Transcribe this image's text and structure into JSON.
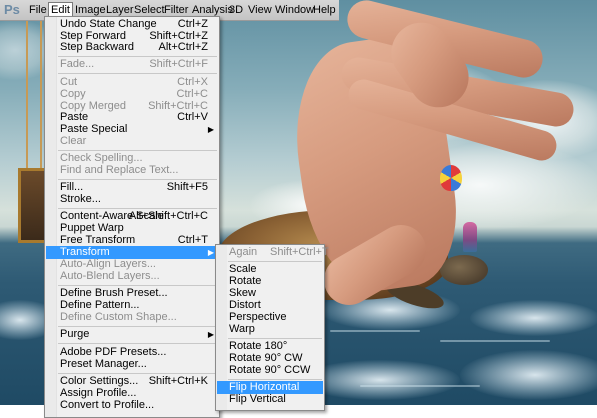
{
  "app": {
    "logo_text": "Ps"
  },
  "menubar": {
    "items": [
      {
        "label": "File"
      },
      {
        "label": "Edit"
      },
      {
        "label": "Image"
      },
      {
        "label": "Layer"
      },
      {
        "label": "Select"
      },
      {
        "label": "Filter"
      },
      {
        "label": "Analysis"
      },
      {
        "label": "3D"
      },
      {
        "label": "View"
      },
      {
        "label": "Window"
      },
      {
        "label": "Help"
      }
    ]
  },
  "edit_menu": {
    "items": [
      {
        "label": "Undo State Change",
        "shortcut": "Ctrl+Z",
        "enabled": true
      },
      {
        "label": "Step Forward",
        "shortcut": "Shift+Ctrl+Z",
        "enabled": true
      },
      {
        "label": "Step Backward",
        "shortcut": "Alt+Ctrl+Z",
        "enabled": true
      },
      {
        "label": "Fade...",
        "shortcut": "Shift+Ctrl+F",
        "enabled": false
      },
      {
        "label": "Cut",
        "shortcut": "Ctrl+X",
        "enabled": false
      },
      {
        "label": "Copy",
        "shortcut": "Ctrl+C",
        "enabled": false
      },
      {
        "label": "Copy Merged",
        "shortcut": "Shift+Ctrl+C",
        "enabled": false
      },
      {
        "label": "Paste",
        "shortcut": "Ctrl+V",
        "enabled": true
      },
      {
        "label": "Paste Special",
        "shortcut": "",
        "enabled": true,
        "submenu": true
      },
      {
        "label": "Clear",
        "shortcut": "",
        "enabled": false
      },
      {
        "label": "Check Spelling...",
        "shortcut": "",
        "enabled": false
      },
      {
        "label": "Find and Replace Text...",
        "shortcut": "",
        "enabled": false
      },
      {
        "label": "Fill...",
        "shortcut": "Shift+F5",
        "enabled": true
      },
      {
        "label": "Stroke...",
        "shortcut": "",
        "enabled": true
      },
      {
        "label": "Content-Aware Scale",
        "shortcut": "Alt+Shift+Ctrl+C",
        "enabled": true
      },
      {
        "label": "Puppet Warp",
        "shortcut": "",
        "enabled": true
      },
      {
        "label": "Free Transform",
        "shortcut": "Ctrl+T",
        "enabled": true
      },
      {
        "label": "Transform",
        "shortcut": "",
        "enabled": true,
        "submenu": true,
        "highlighted": true
      },
      {
        "label": "Auto-Align Layers...",
        "shortcut": "",
        "enabled": false
      },
      {
        "label": "Auto-Blend Layers...",
        "shortcut": "",
        "enabled": false
      },
      {
        "label": "Define Brush Preset...",
        "shortcut": "",
        "enabled": true
      },
      {
        "label": "Define Pattern...",
        "shortcut": "",
        "enabled": true
      },
      {
        "label": "Define Custom Shape...",
        "shortcut": "",
        "enabled": false
      },
      {
        "label": "Purge",
        "shortcut": "",
        "enabled": true,
        "submenu": true
      },
      {
        "label": "Adobe PDF Presets...",
        "shortcut": "",
        "enabled": true
      },
      {
        "label": "Preset Manager...",
        "shortcut": "",
        "enabled": true
      },
      {
        "label": "Color Settings...",
        "shortcut": "Shift+Ctrl+K",
        "enabled": true
      },
      {
        "label": "Assign Profile...",
        "shortcut": "",
        "enabled": true
      },
      {
        "label": "Convert to Profile...",
        "shortcut": "",
        "enabled": true
      }
    ]
  },
  "transform_menu": {
    "items": [
      {
        "label": "Again",
        "shortcut": "Shift+Ctrl+T",
        "enabled": false
      },
      {
        "label": "Scale",
        "shortcut": "",
        "enabled": true
      },
      {
        "label": "Rotate",
        "shortcut": "",
        "enabled": true
      },
      {
        "label": "Skew",
        "shortcut": "",
        "enabled": true
      },
      {
        "label": "Distort",
        "shortcut": "",
        "enabled": true
      },
      {
        "label": "Perspective",
        "shortcut": "",
        "enabled": true
      },
      {
        "label": "Warp",
        "shortcut": "",
        "enabled": true
      },
      {
        "label": "Rotate 180°",
        "shortcut": "",
        "enabled": true
      },
      {
        "label": "Rotate 90° CW",
        "shortcut": "",
        "enabled": true
      },
      {
        "label": "Rotate 90° CCW",
        "shortcut": "",
        "enabled": true
      },
      {
        "label": "Flip Horizontal",
        "shortcut": "",
        "enabled": true,
        "highlighted": true
      },
      {
        "label": "Flip Vertical",
        "shortcut": "",
        "enabled": true
      }
    ]
  },
  "colors": {
    "highlight": "#3399ff",
    "menu_bg": "#f0f0f0",
    "disabled_text": "#8d8d8d"
  }
}
